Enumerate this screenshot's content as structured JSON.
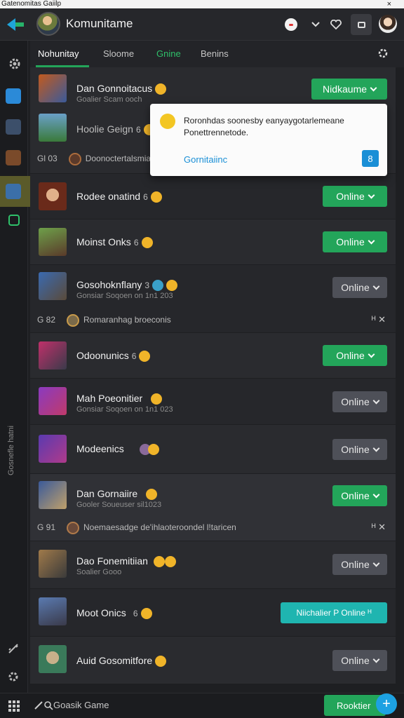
{
  "window": {
    "title": "Gatenomitas Gaiilp",
    "close": "×"
  },
  "header": {
    "app_name": "Komunitame"
  },
  "tabs": [
    {
      "label": "Nohunitay"
    },
    {
      "label": "Sloome"
    },
    {
      "label": "Gnine"
    },
    {
      "label": "Benins"
    }
  ],
  "sidebar": {
    "vertical_label": "Gosnefle hatni"
  },
  "rows": [
    {
      "title": "Dan Gonnoitacus",
      "sub": "Goalier Scam ooch",
      "button": "Nidkaume",
      "btn_style": "green"
    },
    {
      "title": "Hoolie Geign",
      "badge": "6",
      "footer_count": "Gl  03",
      "footer_text": "Doonoctertalsmiaa"
    },
    {
      "title": "Rodee onatind",
      "badge": "6",
      "button": "Online",
      "btn_style": "green"
    },
    {
      "title": "Moinst Onks",
      "badge": "6",
      "button": "Online",
      "btn_style": "green"
    },
    {
      "title": "Gosohoknflany",
      "badge": "3",
      "sub": "Gonsiar Soqoen on 1n1 203",
      "button": "Online",
      "btn_style": "grey",
      "footer_count": "G  82",
      "footer_text": "Romaranhag broeconis",
      "footer_actions": "ᴴ  ✕"
    },
    {
      "title": "Odoonunics",
      "badge": "6",
      "button": "Online",
      "btn_style": "green"
    },
    {
      "title": "Mah Poeonitier",
      "sub": "Gonsiar Soqoen on 1n1 023",
      "button": "Online",
      "btn_style": "grey"
    },
    {
      "title": "Modeenics",
      "badge": "",
      "button": "Online",
      "btn_style": "grey"
    },
    {
      "title": "Dan Gornaiire",
      "sub": "Gooler Soueuser sil1023",
      "button": "Online",
      "btn_style": "green",
      "footer_count": "G  91",
      "footer_text": "Noemaesadge de'ihlaoteroondel l!taricen",
      "footer_actions": "ᴴ  ✕"
    },
    {
      "title": "Dao Fonemitiian",
      "sub": "Soalier Gooo",
      "button": "Online",
      "btn_style": "grey"
    },
    {
      "title": "Moot Onics",
      "badge": "6",
      "button": "Niichalier P Online ᴴ",
      "btn_style": "teal"
    },
    {
      "title": "Auid Gosomitfore",
      "button": "Online",
      "btn_style": "grey"
    }
  ],
  "popup": {
    "text": "Roronhdas soonesby eanyaygotarlemeane Ponettrennetode.",
    "link": "Gornitaiinc",
    "button": "8"
  },
  "bottom": {
    "search_placeholder": "Goasik Game",
    "action_button": "Rooktier",
    "fab": "+"
  },
  "colors": {
    "accent_green": "#23a55a",
    "teal": "#1fb5b0",
    "link_blue": "#1a8fd6"
  }
}
